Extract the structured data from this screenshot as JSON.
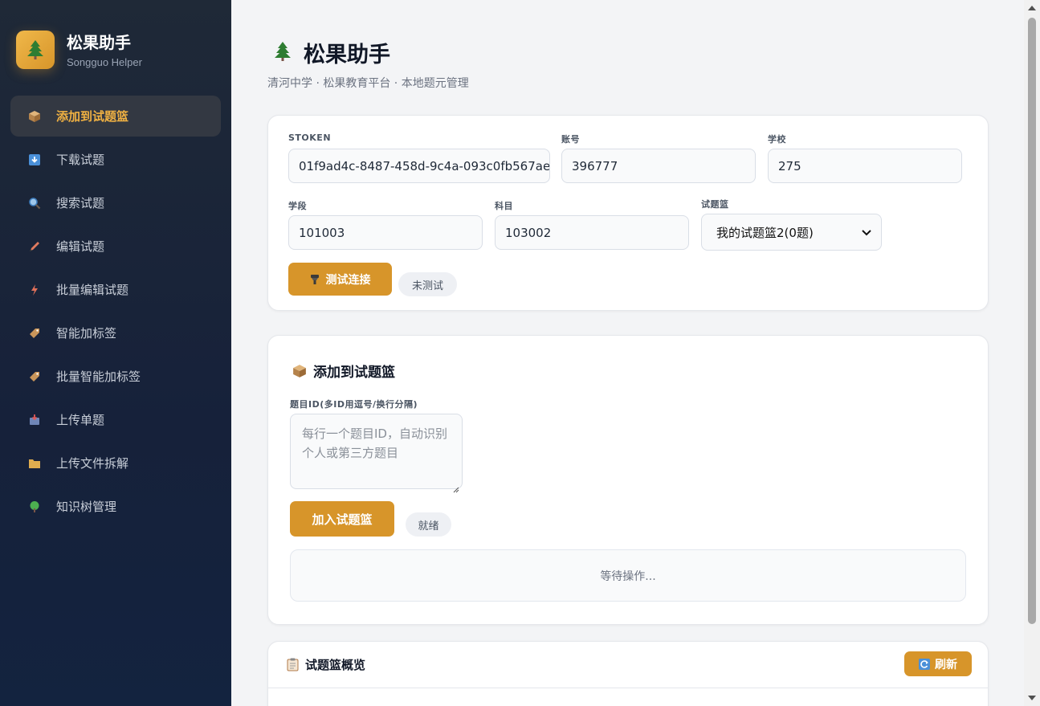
{
  "brand": {
    "title": "松果助手",
    "subtitle": "Songguo Helper",
    "logo_icon": "pine-tree-icon"
  },
  "sidebar": {
    "items": [
      {
        "label": "添加到试题篮",
        "icon": "package-icon",
        "active": true
      },
      {
        "label": "下载试题",
        "icon": "download-icon",
        "active": false
      },
      {
        "label": "搜索试题",
        "icon": "search-icon",
        "active": false
      },
      {
        "label": "编辑试题",
        "icon": "pencil-icon",
        "active": false
      },
      {
        "label": "批量编辑试题",
        "icon": "lightning-icon",
        "active": false
      },
      {
        "label": "智能加标签",
        "icon": "tag-icon",
        "active": false
      },
      {
        "label": "批量智能加标签",
        "icon": "tag-icon",
        "active": false
      },
      {
        "label": "上传单题",
        "icon": "inbox-icon",
        "active": false
      },
      {
        "label": "上传文件拆解",
        "icon": "folder-icon",
        "active": false
      },
      {
        "label": "知识树管理",
        "icon": "tree-icon",
        "active": false
      }
    ]
  },
  "header": {
    "title": "松果助手",
    "subtitle": "清河中学 · 松果教育平台 · 本地题元管理"
  },
  "connection": {
    "stoken_label": "STOKEN",
    "stoken_value": "01f9ad4c-8487-458d-9c4a-093c0fb567ae",
    "account_label": "账号",
    "account_value": "396777",
    "school_label": "学校",
    "school_value": "275",
    "stage_label": "学段",
    "stage_value": "101003",
    "subject_label": "科目",
    "subject_value": "103002",
    "basket_label": "试题篮",
    "basket_selected": "我的试题篮2(0题)",
    "test_button": "测试连接",
    "status": "未测试"
  },
  "add_section": {
    "title": "添加到试题篮",
    "ids_label": "题目ID(多ID用逗号/换行分隔)",
    "ids_placeholder": "每行一个题目ID，自动识别个人或第三方题目",
    "add_button": "加入试题篮",
    "status": "就绪",
    "output": "等待操作..."
  },
  "overview": {
    "title": "试题篮概览",
    "refresh_button": "刷新"
  },
  "colors": {
    "accent": "#d7952a",
    "active_text": "#f0b142",
    "sidebar_bg": "#1f2937"
  }
}
